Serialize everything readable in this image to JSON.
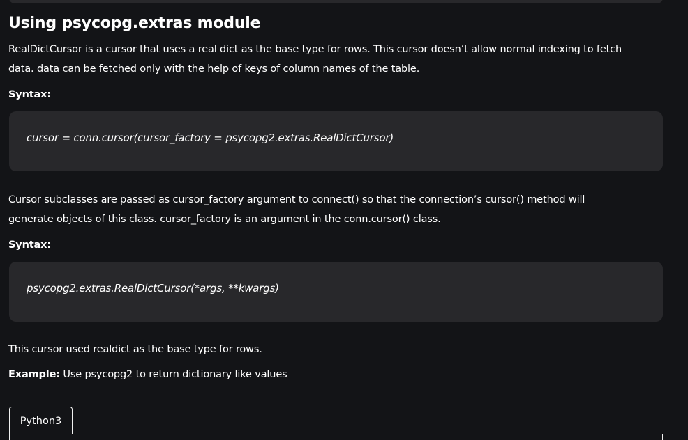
{
  "article": {
    "heading": "Using psycopg.extras module",
    "intro": [
      "RealDictCursor is a cursor that uses a real dict as the base type for rows. This cursor doesn’t allow normal indexing to fetch",
      "data. data can be fetched only with the help of keys of column names of the table."
    ],
    "syntax_label_1": "Syntax:",
    "code_1": "cursor = conn.cursor(cursor_factory = psycopg2.extras.RealDictCursor)",
    "subclass_para": [
      "Cursor subclasses are passed as cursor_factory argument to connect() so that the connection’s cursor() method will",
      "generate objects of this class. cursor_factory is an argument in the conn.cursor() class."
    ],
    "syntax_label_2": "Syntax:",
    "code_2": "psycopg2.extras.RealDictCursor(*args, **kwargs)",
    "base_type_para": "This cursor used realdict as the base type for rows.",
    "example_label": "Example:",
    "example_text": " Use psycopg2 to return dictionary like values"
  },
  "tabs": [
    {
      "label": "Python3",
      "active": true
    }
  ]
}
